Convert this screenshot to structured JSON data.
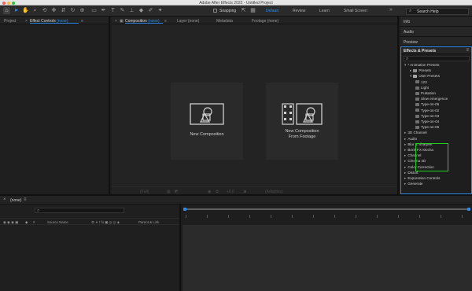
{
  "window": {
    "title": "Adobe After Effects 2022 - Untitled Project"
  },
  "toolbar": {
    "snapping_label": "Snapping",
    "workspaces": [
      "Default",
      "Review",
      "Learn",
      "Small Screen"
    ],
    "active_workspace": "Default",
    "search_label": "Search Help"
  },
  "project_panel": {
    "tabs": [
      "Project",
      "Effect Controls",
      "(none)"
    ]
  },
  "composition_panel": {
    "tabs": [
      "Composition",
      "(none)",
      "Layer (none)",
      "Metadata",
      "Footage (none)"
    ],
    "cards": [
      {
        "label": "New Composition"
      },
      {
        "label_line1": "New Composition",
        "label_line2": "From Footage"
      }
    ],
    "bottom_bar": [
      "(Full)",
      "+0.0",
      "(Adaptive)"
    ]
  },
  "right_panels": {
    "info": "Info",
    "audio": "Audio",
    "preview": "Preview",
    "effects_title": "Effects & Presets",
    "tree": [
      {
        "label": "* Animation Presets",
        "indent": 0,
        "kind": "open"
      },
      {
        "label": "Presets",
        "indent": 1,
        "kind": "folder"
      },
      {
        "label": "User Presets",
        "indent": 1,
        "kind": "open"
      },
      {
        "label": "123",
        "indent": 2,
        "kind": "fx"
      },
      {
        "label": "Light",
        "indent": 2,
        "kind": "fx"
      },
      {
        "label": "Pulsation",
        "indent": 2,
        "kind": "fx"
      },
      {
        "label": "Slow emergence",
        "indent": 2,
        "kind": "fx"
      },
      {
        "label": "Type-on-05",
        "indent": 2,
        "kind": "fx"
      },
      {
        "label": "Type-on-02",
        "indent": 2,
        "kind": "fx"
      },
      {
        "label": "Type-on-03",
        "indent": 2,
        "kind": "fx"
      },
      {
        "label": "Type-on-04",
        "indent": 2,
        "kind": "fx"
      },
      {
        "label": "Type-on-06",
        "indent": 2,
        "kind": "fx"
      },
      {
        "label": "3D Channel",
        "indent": 0,
        "kind": "closed"
      },
      {
        "label": "Audio",
        "indent": 0,
        "kind": "closed"
      },
      {
        "label": "Blur & Sharpen",
        "indent": 0,
        "kind": "closed"
      },
      {
        "label": "Boris FX Mocha",
        "indent": 0,
        "kind": "closed"
      },
      {
        "label": "Channel",
        "indent": 0,
        "kind": "closed"
      },
      {
        "label": "Cinema 4D",
        "indent": 0,
        "kind": "closed"
      },
      {
        "label": "Color Correction",
        "indent": 0,
        "kind": "closed"
      },
      {
        "label": "Distort",
        "indent": 0,
        "kind": "closed"
      },
      {
        "label": "Expression Controls",
        "indent": 0,
        "kind": "closed"
      },
      {
        "label": "Generate",
        "indent": 0,
        "kind": "closed"
      }
    ]
  },
  "timeline": {
    "tab_label": "(none)",
    "columns": [
      "Source Name",
      "Parent & Link"
    ]
  },
  "colors": {
    "accent": "#2d8ceb",
    "highlight": "#1fd01f"
  }
}
